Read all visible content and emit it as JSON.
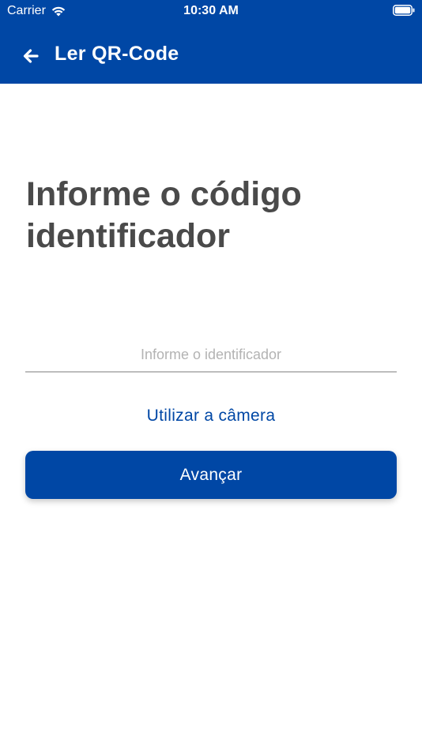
{
  "status_bar": {
    "carrier": "Carrier",
    "time": "10:30 AM"
  },
  "toolbar": {
    "title": "Ler QR-Code",
    "back_icon": "arrow-left-icon"
  },
  "main": {
    "heading": "Informe o código identificador",
    "input": {
      "placeholder": "Informe o identificador",
      "value": ""
    },
    "camera_link": "Utilizar a câmera",
    "next_button": "Avançar"
  },
  "colors": {
    "primary": "#0047a5",
    "heading_text": "#4a4a4a",
    "placeholder": "#b3b3b3",
    "input_underline": "#bdbdbd"
  }
}
